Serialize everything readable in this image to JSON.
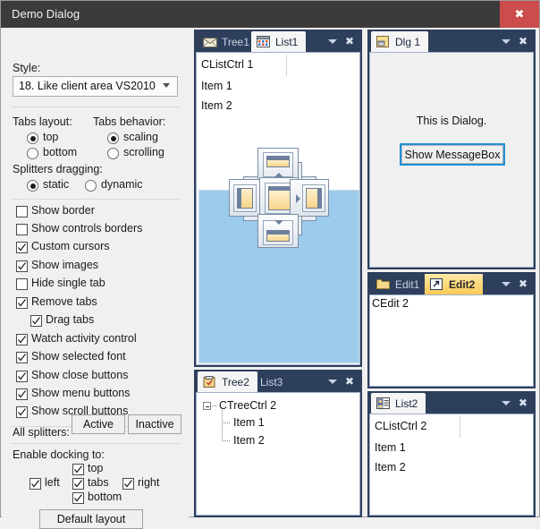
{
  "window": {
    "title": "Demo Dialog",
    "close_label": "✖",
    "close_color": "#cc4b4b",
    "titlebar_color": "#3b3b3b"
  },
  "options": {
    "style_label": "Style:",
    "style_value": "18. Like client area VS2010",
    "style_options": [
      "18. Like client area VS2010"
    ],
    "tabs_layout_label": "Tabs layout:",
    "tabs_layout": [
      {
        "label": "top",
        "selected": true
      },
      {
        "label": "bottom",
        "selected": false
      }
    ],
    "tabs_behavior_label": "Tabs behavior:",
    "tabs_behavior": [
      {
        "label": "scaling",
        "selected": true
      },
      {
        "label": "scrolling",
        "selected": false
      }
    ],
    "splitters_label": "Splitters dragging:",
    "splitters": [
      {
        "label": "static",
        "selected": true
      },
      {
        "label": "dynamic",
        "selected": false
      }
    ],
    "checkgroup_1": [
      {
        "label": "Show border",
        "checked": false
      },
      {
        "label": "Show controls borders",
        "checked": false
      },
      {
        "label": "Custom cursors",
        "checked": true
      }
    ],
    "checkgroup_2": [
      {
        "label": "Show images",
        "checked": true
      },
      {
        "label": "Hide single tab",
        "checked": false
      }
    ],
    "checkgroup_3": [
      {
        "label": "Remove tabs",
        "checked": true
      },
      {
        "label": "Drag tabs",
        "checked": true,
        "indent": true
      }
    ],
    "checkgroup_4": [
      {
        "label": "Watch activity control",
        "checked": true
      },
      {
        "label": "Show selected font",
        "checked": true
      }
    ],
    "checkgroup_5": [
      {
        "label": "Show close buttons",
        "checked": true
      },
      {
        "label": "Show menu buttons",
        "checked": true
      },
      {
        "label": "Show scroll buttons",
        "checked": true
      }
    ],
    "all_splitters_label": "All splitters:",
    "active_button": "Active",
    "inactive_button": "Inactive",
    "docking_label": "Enable docking to:",
    "docking": [
      {
        "label": "top",
        "checked": true
      },
      {
        "label": "left",
        "checked": true
      },
      {
        "label": "tabs",
        "checked": true
      },
      {
        "label": "right",
        "checked": true
      },
      {
        "label": "bottom",
        "checked": true
      }
    ],
    "default_layout_button": "Default layout"
  },
  "panels": {
    "tree_list_1": {
      "tabs": [
        {
          "label": "Tree1",
          "icon": "mail-icon",
          "active": false
        },
        {
          "label": "List1",
          "icon": "calendar-icon",
          "active": true
        }
      ],
      "content_title": "CListCtrl 1",
      "items": [
        "Item 1",
        "Item 2"
      ]
    },
    "dlg1": {
      "tabs": [
        {
          "label": "Dlg 1",
          "icon": "window-icon",
          "active": true
        }
      ],
      "text": "This is Dialog.",
      "button": "Show MessageBox"
    },
    "edit": {
      "tabs": [
        {
          "label": "Edit1",
          "icon": "folder-icon",
          "active": false
        },
        {
          "label": "Edit2",
          "icon": "shortcut-icon",
          "active": true
        }
      ],
      "content": "CEdit 2"
    },
    "tree2": {
      "tabs": [
        {
          "label": "Tree2",
          "icon": "clipboard-icon",
          "active": true
        },
        {
          "label": "List3",
          "icon": "",
          "active": false
        }
      ],
      "root": "CTreeCtrl 2",
      "children": [
        "Item 1",
        "Item 2"
      ]
    },
    "list2": {
      "tabs": [
        {
          "label": "List2",
          "icon": "contact-icon",
          "active": true
        }
      ],
      "content_title": "CListCtrl 2",
      "items": [
        "Item 1",
        "Item 2"
      ]
    },
    "tab_buttons": {
      "menu_icon": "chevron-down-icon",
      "close_icon": "close-icon"
    }
  },
  "dock_guide": {
    "preview_color": "#9ccbec",
    "directions": [
      "top",
      "left",
      "center",
      "right",
      "bottom"
    ]
  }
}
